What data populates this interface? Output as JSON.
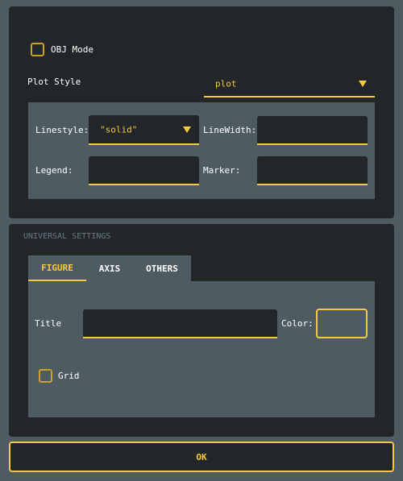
{
  "top": {
    "obj_mode_label": "OBJ Mode",
    "obj_mode_checked": false,
    "plot_style_label": "Plot Style",
    "plot_style_value": "plot",
    "linestyle_label": "Linestyle:",
    "linestyle_value": "\"solid\"",
    "linewidth_label": "LineWidth:",
    "linewidth_value": "",
    "legend_label": "Legend:",
    "legend_value": "",
    "marker_label": "Marker:",
    "marker_value": ""
  },
  "universal": {
    "section_title": "UNIVERSAL SETTINGS",
    "tabs": [
      {
        "label": "FIGURE",
        "active": true
      },
      {
        "label": "AXIS",
        "active": false
      },
      {
        "label": "OTHERS",
        "active": false
      }
    ],
    "title_label": "Title",
    "title_value": "",
    "color_label": "Color:",
    "grid_label": "Grid",
    "grid_checked": false
  },
  "ok_label": "OK",
  "colors": {
    "accent": "#f6c945",
    "panel": "#232629",
    "background": "#4f5b63"
  }
}
